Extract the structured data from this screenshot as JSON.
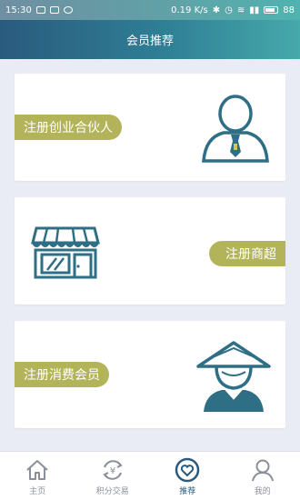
{
  "statusbar": {
    "time": "15:30",
    "network_speed": "0.19 K/s",
    "battery": "88"
  },
  "header": {
    "title": "会员推荐"
  },
  "cards": [
    {
      "label": "注册创业合伙人",
      "icon": "person-with-tie-icon"
    },
    {
      "label": "注册商超",
      "icon": "storefront-icon"
    },
    {
      "label": "注册消费会员",
      "icon": "farmer-with-hat-icon"
    }
  ],
  "tabs": [
    {
      "label": "主页",
      "icon": "home-icon",
      "active": false
    },
    {
      "label": "积分交易",
      "icon": "yuan-exchange-icon",
      "active": false
    },
    {
      "label": "推荐",
      "icon": "heart-icon",
      "active": true
    },
    {
      "label": "我的",
      "icon": "user-icon",
      "active": false
    }
  ],
  "colors": {
    "header_start": "#2a5b7e",
    "header_end": "#46a9ab",
    "pill": "#b3b45a",
    "icon": "#2e6f86",
    "background": "#e9ecf5"
  }
}
